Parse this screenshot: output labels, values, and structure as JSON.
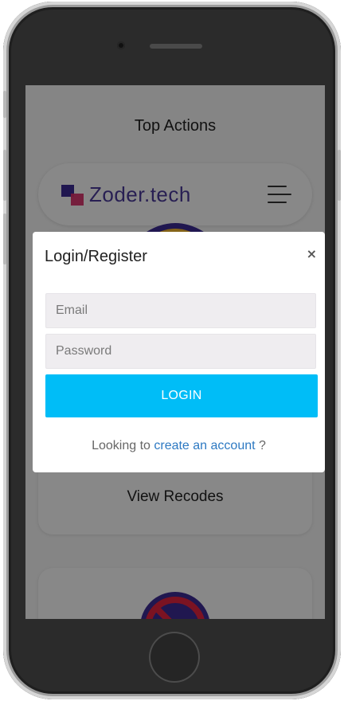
{
  "page": {
    "title": "Top Actions",
    "logo_text": "Zoder.tech",
    "card_label": "View Recodes"
  },
  "modal": {
    "title": "Login/Register",
    "close_symbol": "×",
    "email_placeholder": "Email",
    "password_placeholder": "Password",
    "login_label": "LOGIN",
    "footer_prefix": "Looking to ",
    "footer_link": "create an account",
    "footer_suffix": " ?"
  },
  "colors": {
    "accent": "#00bdf7",
    "link": "#2d79c2",
    "logo_purple": "#3b2b92",
    "logo_pink": "#d62f68"
  },
  "icons": [
    "hamburger-menu-icon",
    "close-icon",
    "play-icon",
    "block-icon"
  ]
}
